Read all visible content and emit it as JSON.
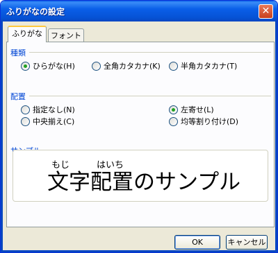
{
  "window": {
    "title": "ふりがなの設定",
    "close_glyph": "✕"
  },
  "tabs": [
    {
      "label": "ふりがな",
      "active": true
    },
    {
      "label": "フォント",
      "active": false
    }
  ],
  "type_group": {
    "label": "種類",
    "options": [
      {
        "label": "ひらがな(H)",
        "checked": true
      },
      {
        "label": "全角カタカナ(K)",
        "checked": false
      },
      {
        "label": "半角カタカナ(T)",
        "checked": false
      }
    ]
  },
  "align_group": {
    "label": "配置",
    "options": [
      {
        "label": "指定なし(N)",
        "checked": false
      },
      {
        "label": "中央揃え(C)",
        "checked": false
      },
      {
        "label": "左寄せ(L)",
        "checked": true
      },
      {
        "label": "均等割り付け(D)",
        "checked": false
      }
    ]
  },
  "sample": {
    "label": "サンプル",
    "ruby_1": "もじ",
    "ruby_2": "はいち",
    "text": "文字配置のサンプル"
  },
  "buttons": {
    "ok": "OK",
    "cancel": "キャンセル"
  },
  "colors": {
    "accent": "#0046d5",
    "titlebar": "#0a5fe8",
    "dialog_bg": "#ece9d8"
  }
}
